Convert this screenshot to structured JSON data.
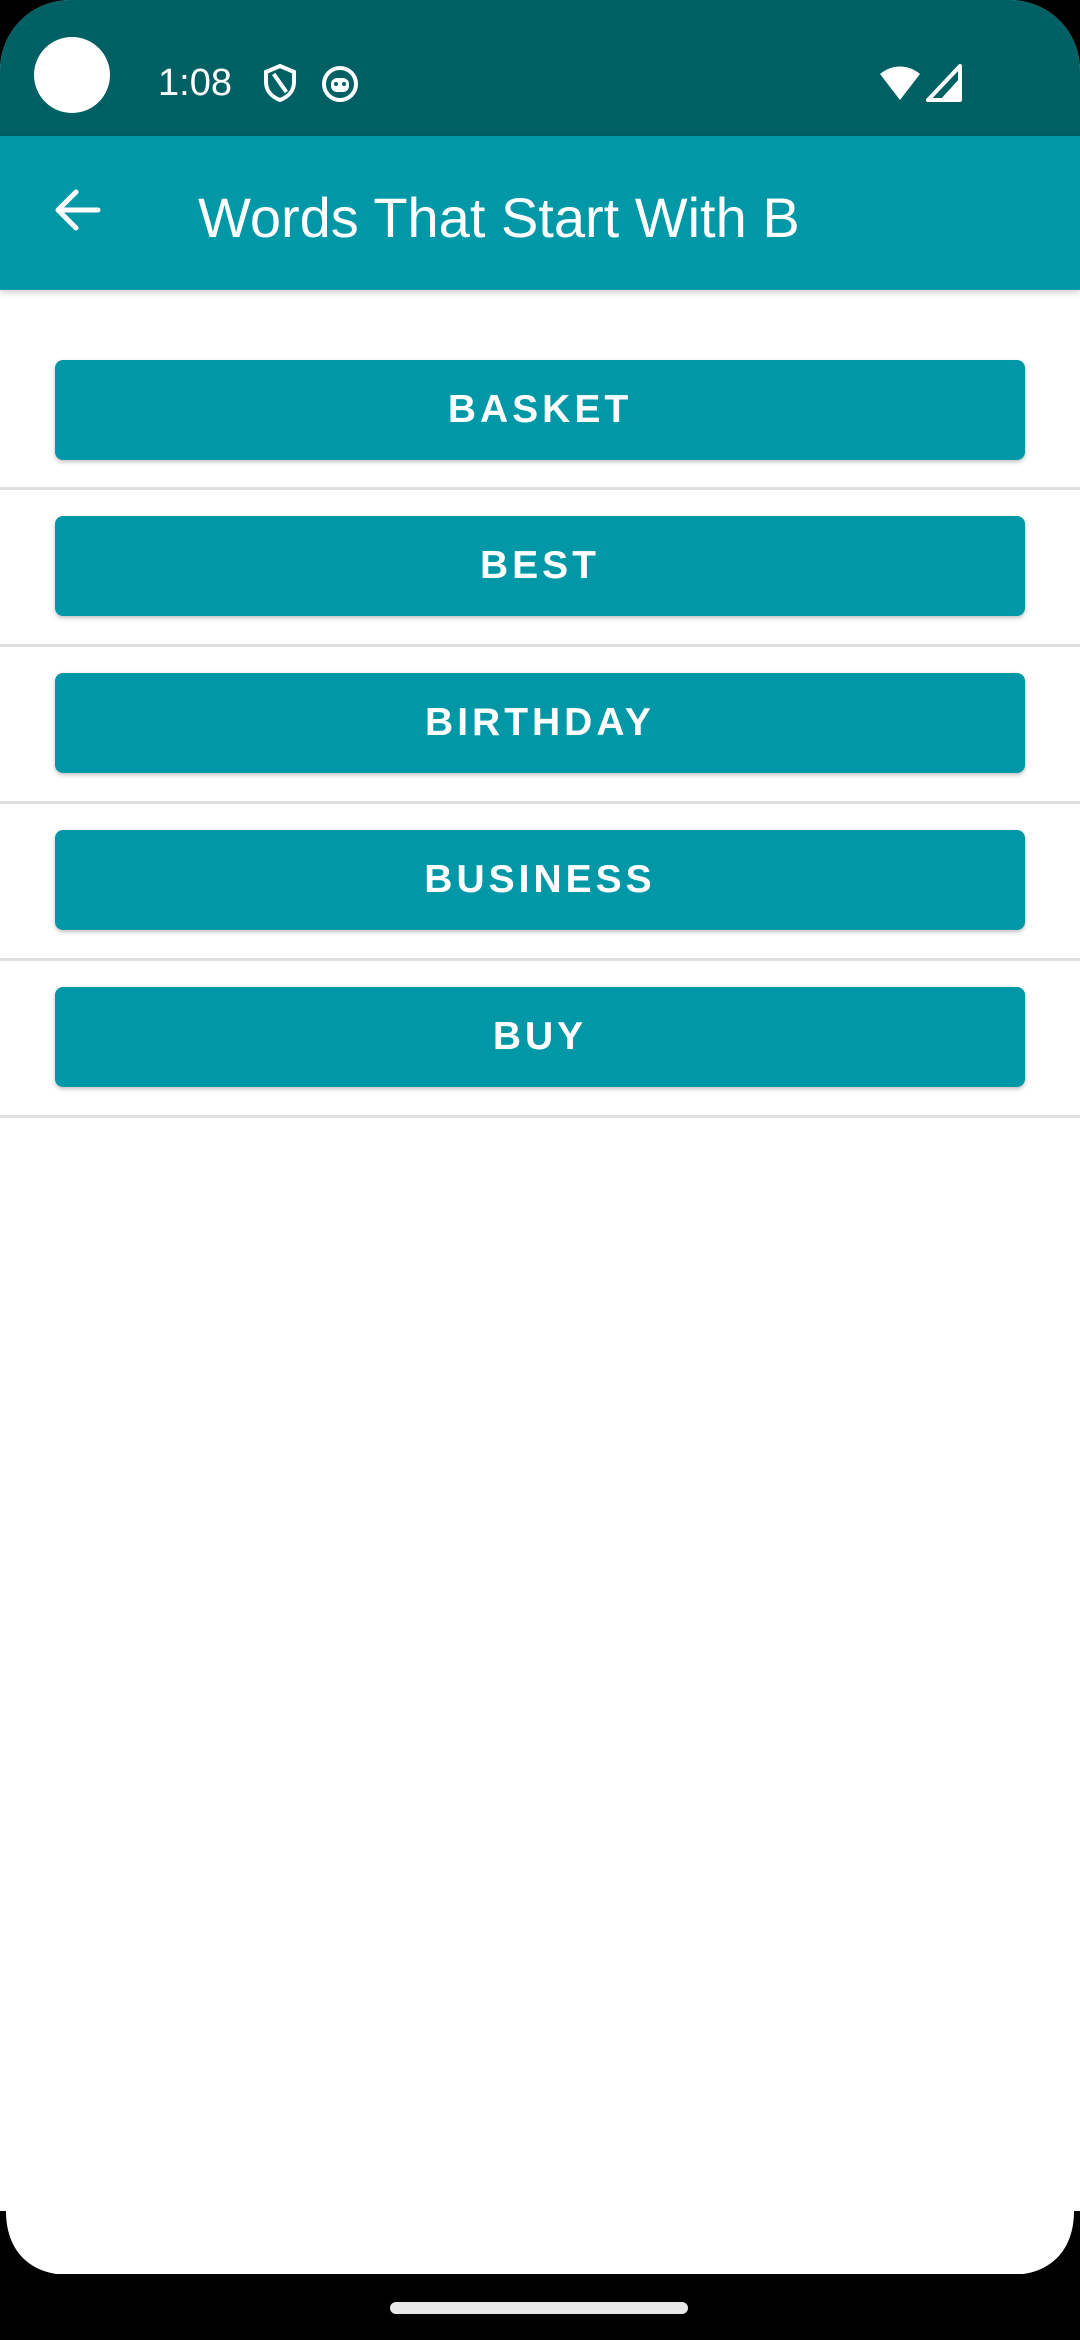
{
  "status_bar": {
    "time": "1:08",
    "icons": [
      "shield-icon",
      "android-icon",
      "wifi-icon",
      "signal-icon"
    ],
    "background": "#006064"
  },
  "app_bar": {
    "title": "Words That Start With B",
    "back_icon": "arrow-back-icon",
    "background": "#0097a7"
  },
  "words": [
    {
      "label": "BASKET"
    },
    {
      "label": "BEST"
    },
    {
      "label": "BIRTHDAY"
    },
    {
      "label": "BUSINESS"
    },
    {
      "label": "BUY"
    }
  ],
  "colors": {
    "accent": "#0097a7",
    "divider": "#e0e0e0"
  }
}
